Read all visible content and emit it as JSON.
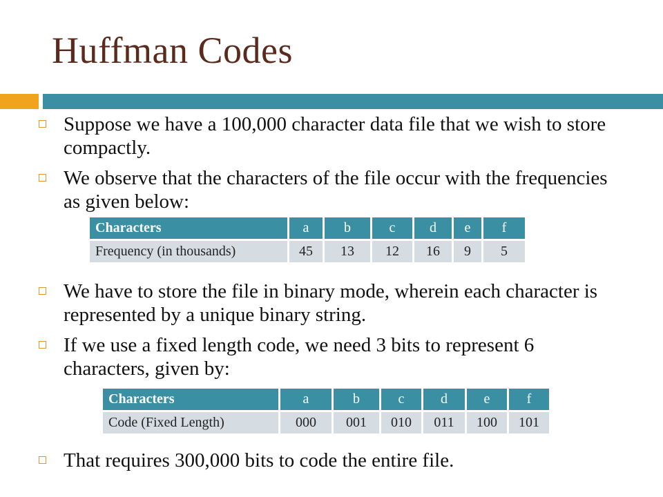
{
  "title": "Huffman Codes",
  "colors": {
    "title": "#5a2a1c",
    "accent_orange": "#f0a31c",
    "accent_teal": "#3a8fa3",
    "table_row": "#d5dde2"
  },
  "bullets": [
    "Suppose we have a 100,000 character data file that we wish to store compactly.",
    "We observe that the characters of the file occur with the frequencies as given below:",
    "We have to store the file in binary mode, wherein each character is represented by a unique binary string.",
    "If we use a fixed length code, we need 3 bits to represent 6 characters, given by:",
    "That requires 300,000 bits to code the entire file."
  ],
  "table_frequency": {
    "header": [
      "Characters",
      "a",
      "b",
      "c",
      "d",
      "e",
      "f"
    ],
    "row": [
      "Frequency (in thousands)",
      "45",
      "13",
      "12",
      "16",
      "9",
      "5"
    ]
  },
  "table_code": {
    "header": [
      "Characters",
      "a",
      "b",
      "c",
      "d",
      "e",
      "f"
    ],
    "row": [
      "Code (Fixed Length)",
      "000",
      "001",
      "010",
      "011",
      "100",
      "101"
    ]
  }
}
